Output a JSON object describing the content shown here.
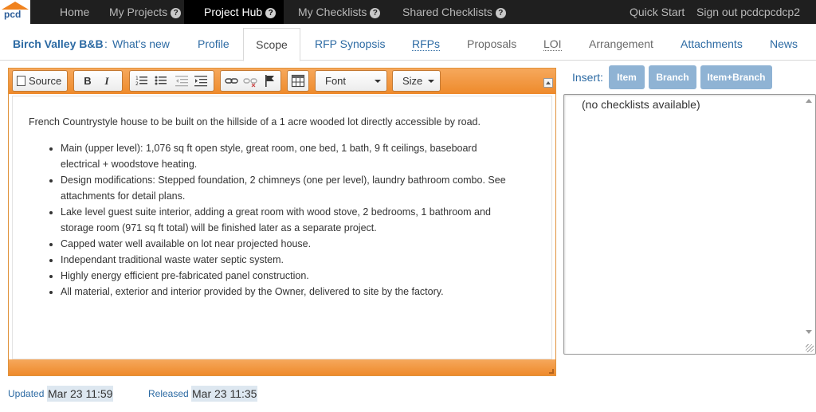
{
  "brand": {
    "logo_text": "pcd"
  },
  "topnav": {
    "home": "Home",
    "my_projects": "My Projects",
    "project_hub": "Project Hub",
    "my_checklists": "My Checklists",
    "shared_checklists": "Shared Checklists",
    "quick_start": "Quick Start",
    "sign_out": "Sign out pcdcpcdcp2",
    "help_glyph": "?"
  },
  "project": {
    "name": "Birch Valley B&B",
    "separator": ":",
    "whats_new": "What's new"
  },
  "tabs": {
    "profile": "Profile",
    "scope": "Scope",
    "rfp_synopsis": "RFP Synopsis",
    "rfps": "RFPs",
    "proposals": "Proposals",
    "loi": "LOI",
    "arrangement": "Arrangement",
    "attachments": "Attachments",
    "news": "News"
  },
  "editor": {
    "toolbar": {
      "source": "Source",
      "bold": "B",
      "italic": "I",
      "font": "Font",
      "size": "Size"
    },
    "content": {
      "intro": "French Countrystyle house to be built on the hillside of a 1 acre wooded lot directly accessible by road.",
      "bullets": [
        "Main (upper level): 1,076 sq ft open style, great room, one bed, 1 bath, 9 ft ceilings, baseboard electrical + woodstove heating.",
        "Design modifications: Stepped foundation, 2 chimneys (one per level), laundry bathroom combo. See attachments for detail plans.",
        "Lake level guest suite interior, adding a great room with wood stove, 2 bedrooms, 1 bathroom and storage room (971 sq ft total) will be finished later as a separate project.",
        "Capped water well available on lot near projected house.",
        "Independant traditional waste water septic system.",
        "Highly energy efficient pre-fabricated panel construction.",
        "All material, exterior and interior provided by the Owner, delivered to site by the factory."
      ]
    }
  },
  "insert_panel": {
    "label": "Insert:",
    "buttons": {
      "item": "Item",
      "branch": "Branch",
      "item_branch": "Item+Branch"
    },
    "empty_text": "(no checklists available)"
  },
  "status": {
    "updated_label": "Updated",
    "updated_value": "Mar 23 11:59",
    "released_label": "Released",
    "released_value": "Mar 23 11:35"
  },
  "colors": {
    "topnav_bg": "#1f1f1f",
    "link": "#2c6aa3",
    "toolbar_orange": "#ee8a2b",
    "insert_button": "#8fb3d4",
    "logo_orange": "#f0821e"
  }
}
